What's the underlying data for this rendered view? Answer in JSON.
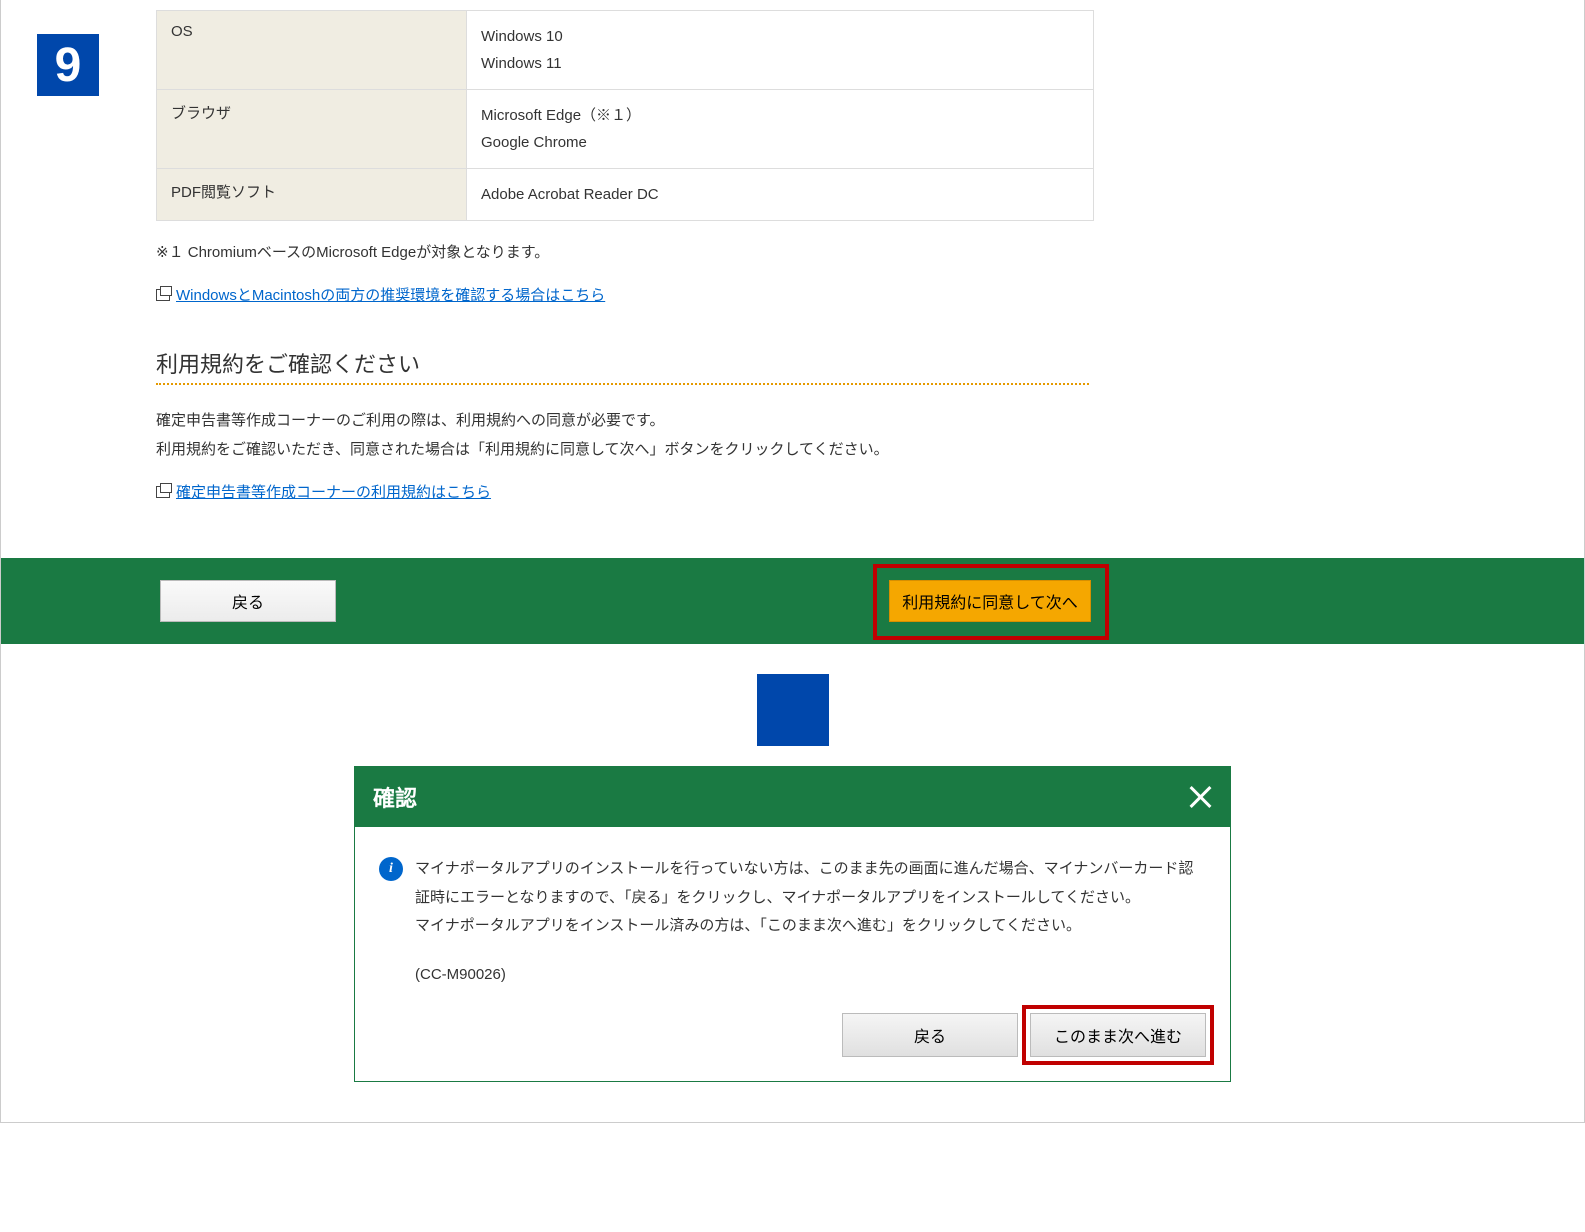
{
  "step_number": "9",
  "env_table": {
    "rows": [
      {
        "label": "OS",
        "values": [
          "Windows 10",
          "Windows 11"
        ]
      },
      {
        "label": "ブラウザ",
        "values": [
          "Microsoft Edge（※１）",
          "Google Chrome"
        ]
      },
      {
        "label": "PDF閲覧ソフト",
        "values": [
          "Adobe Acrobat Reader DC"
        ]
      }
    ]
  },
  "footnote1": "※１ ChromiumベースのMicrosoft Edgeが対象となります。",
  "env_link": "WindowsとMacintoshの両方の推奨環境を確認する場合はこちら",
  "terms_section": {
    "title": "利用規約をご確認ください",
    "p1": "確定申告書等作成コーナーのご利用の際は、利用規約への同意が必要です。",
    "p2": "利用規約をご確認いただき、同意された場合は「利用規約に同意して次へ」ボタンをクリックしてください。",
    "link": "確定申告書等作成コーナーの利用規約はこちら"
  },
  "actions": {
    "back": "戻る",
    "agree_next": "利用規約に同意して次へ"
  },
  "modal": {
    "title": "確認",
    "info_symbol": "i",
    "p1": "マイナポータルアプリのインストールを行っていない方は、このまま先の画面に進んだ場合、マイナンバーカード認証時にエラーとなりますので、「戻る」をクリックし、マイナポータルアプリをインストールしてください。",
    "p2": "マイナポータルアプリをインストール済みの方は、「このまま次へ進む」をクリックしてください。",
    "code": "(CC-M90026)",
    "back": "戻る",
    "proceed": "このまま次へ進む"
  }
}
